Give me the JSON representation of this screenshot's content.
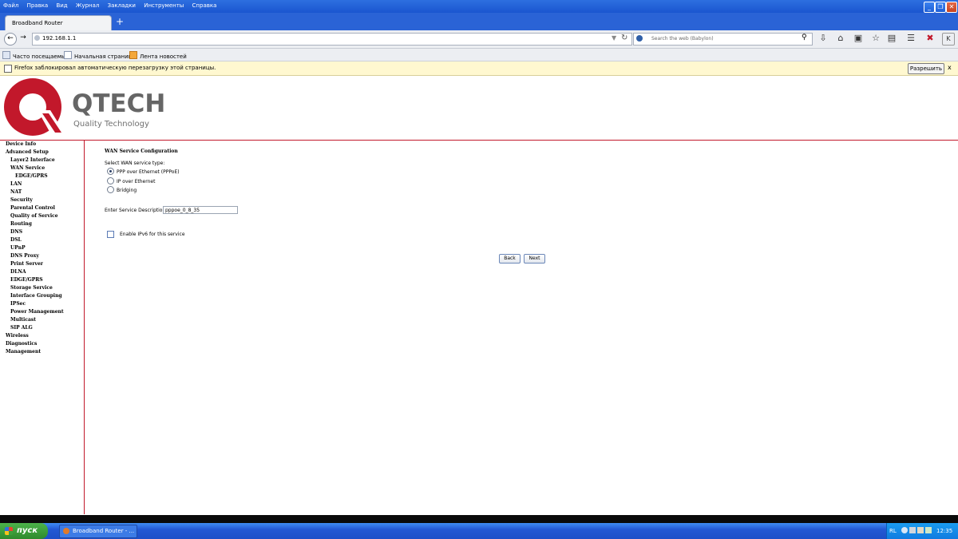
{
  "window": {
    "menu": [
      "Файл",
      "Правка",
      "Вид",
      "Журнал",
      "Закладки",
      "Инструменты",
      "Справка"
    ],
    "minimize": "_",
    "maximize": "❐",
    "close": "✕"
  },
  "tab": {
    "title": "Broadband Router",
    "new_tab": "+"
  },
  "nav": {
    "url": "192.168.1.1",
    "search_placeholder": "Search the web (Babylon)"
  },
  "bookmarks": [
    "Часто посещаемые",
    "Начальная страница",
    "Лента новостей"
  ],
  "notification": {
    "text": "Firefox заблокировал автоматическую перезагрузку этой страницы.",
    "allow_button": "Разрешить",
    "close": "x"
  },
  "brand": {
    "name": "QTECH",
    "tagline": "Quality Technology",
    "colors": {
      "logo_red": "#c2182b",
      "logo_gray": "#666666"
    }
  },
  "sidebar": {
    "items": [
      {
        "label": "Device Info",
        "level": 0
      },
      {
        "label": "Advanced Setup",
        "level": 0
      },
      {
        "label": "Layer2 Interface",
        "level": 1
      },
      {
        "label": "WAN Service",
        "level": 1
      },
      {
        "label": "EDGE/GPRS",
        "level": 2
      },
      {
        "label": "LAN",
        "level": 1
      },
      {
        "label": "NAT",
        "level": 1
      },
      {
        "label": "Security",
        "level": 1
      },
      {
        "label": "Parental Control",
        "level": 1
      },
      {
        "label": "Quality of Service",
        "level": 1
      },
      {
        "label": "Routing",
        "level": 1
      },
      {
        "label": "DNS",
        "level": 1
      },
      {
        "label": "DSL",
        "level": 1
      },
      {
        "label": "UPnP",
        "level": 1
      },
      {
        "label": "DNS Proxy",
        "level": 1
      },
      {
        "label": "Print Server",
        "level": 1
      },
      {
        "label": "DLNA",
        "level": 1
      },
      {
        "label": "EDGE/GPRS",
        "level": 1
      },
      {
        "label": "Storage Service",
        "level": 1
      },
      {
        "label": "Interface Grouping",
        "level": 1
      },
      {
        "label": "IPSec",
        "level": 1
      },
      {
        "label": "Power Management",
        "level": 1
      },
      {
        "label": "Multicast",
        "level": 1
      },
      {
        "label": "SIP ALG",
        "level": 1
      },
      {
        "label": "Wireless",
        "level": 0
      },
      {
        "label": "Diagnostics",
        "level": 0
      },
      {
        "label": "Management",
        "level": 0
      }
    ]
  },
  "form": {
    "title": "WAN Service Configuration",
    "select_label": "Select WAN service type:",
    "options": [
      {
        "label": "PPP over Ethernet (PPPoE)",
        "selected": true
      },
      {
        "label": "IP over Ethernet",
        "selected": false
      },
      {
        "label": "Bridging",
        "selected": false
      }
    ],
    "desc_label": "Enter Service Description:",
    "desc_value": "pppoe_0_8_35",
    "ipv6_label": "Enable IPv6 for this service",
    "ipv6_checked": false,
    "back": "Back",
    "next": "Next"
  },
  "taskbar": {
    "start": "пуск",
    "task": "Broadband Router - ...",
    "lang": "RL",
    "clock": "12:35"
  }
}
